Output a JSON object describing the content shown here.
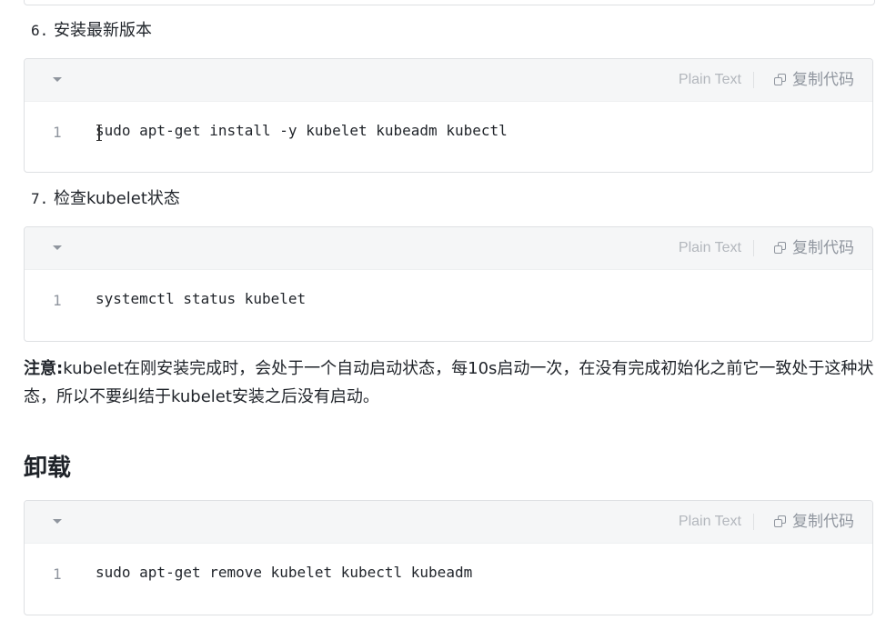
{
  "steps": [
    {
      "num": "6.",
      "label": "安装最新版本"
    },
    {
      "num": "7.",
      "label": "检查kubelet状态"
    }
  ],
  "code_blocks": [
    {
      "lang": "Plain Text",
      "copy_label": "复制代码",
      "line_number": "1",
      "code": "sudo apt-get install -y kubelet kubeadm kubectl"
    },
    {
      "lang": "Plain Text",
      "copy_label": "复制代码",
      "line_number": "1",
      "code": "systemctl status kubelet"
    },
    {
      "lang": "Plain Text",
      "copy_label": "复制代码",
      "line_number": "1",
      "code": "sudo apt-get remove kubelet kubectl kubeadm"
    }
  ],
  "note": {
    "label": "注意:",
    "text": "kubelet在刚安装完成时，会处于一个自动启动状态，每10s启动一次，在没有完成初始化之前它一致处于这种状态，所以不要纠结于kubelet安装之后没有启动。"
  },
  "section_heading": "卸载",
  "icons": {
    "collapse": "caret-down-icon",
    "copy": "copy-icon",
    "cursor": "text-cursor-icon"
  }
}
